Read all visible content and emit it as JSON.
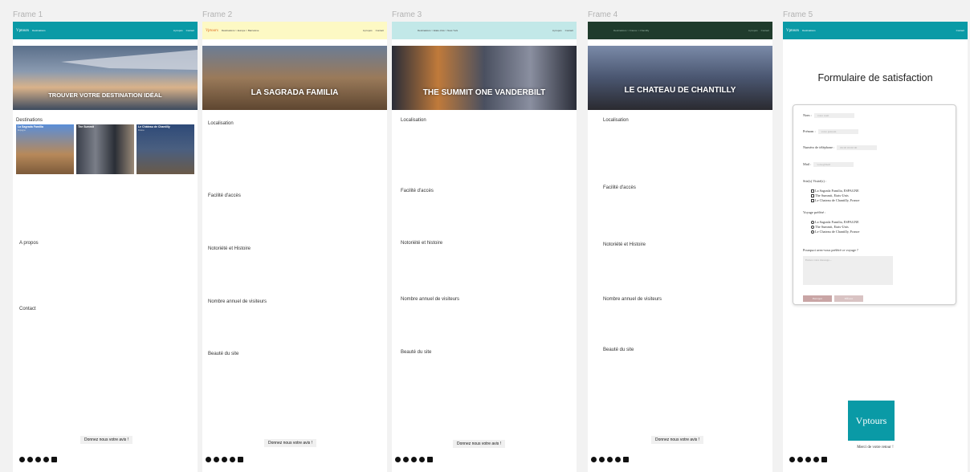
{
  "frames": [
    {
      "label": "Frame 1"
    },
    {
      "label": "Frame 2"
    },
    {
      "label": "Frame 3"
    },
    {
      "label": "Frame 4"
    },
    {
      "label": "Frame 5"
    }
  ],
  "colors": {
    "teal": "#0a9aa6",
    "yellow": "#fdf9c4",
    "light_teal": "#c2e8e8",
    "dark_green": "#1f3b2c"
  },
  "frame1": {
    "logo": "Vptours",
    "nav_dest": "Destinations",
    "nav_apropos": "A propos",
    "nav_contact": "Contact",
    "hero_title": "TROUVER VOTRE DESTINATION IDÉAL",
    "destinations_heading": "Destinations",
    "cards": [
      {
        "name": "La Sagrada Familia",
        "sub": "Espagne"
      },
      {
        "name": "The Summit",
        "sub": ""
      },
      {
        "name": "Le Château de Chantilly",
        "sub": "France"
      }
    ],
    "apropos": "A propos",
    "contact": "Contact",
    "cta": "Donnez nous votre avis !"
  },
  "frame2": {
    "logo": "Vptours",
    "breadcrumb": "Destinations > Europe > Barcelone",
    "nav_apropos": "A propos",
    "nav_contact": "Contact",
    "hero_title": "LA SAGRADA FAMILIA",
    "sections": [
      "Localisation",
      "Facilité d'accès",
      "Notoriété et Histoire",
      "Nombre annuel de visiteurs",
      "Beauté du site"
    ],
    "cta": "Donnez nous votre avis !"
  },
  "frame3": {
    "breadcrumb": "Destinations > Etats-Unis > New-York",
    "nav_apropos": "A propos",
    "nav_contact": "Contact",
    "hero_title": "THE SUMMIT ONE VANDERBILT",
    "sections": [
      "Localisation",
      "Facilité d'accès",
      "Notoriété et histoire",
      "Nombre annuel de visiteurs",
      "Beauté du site"
    ],
    "cta": "Donnez nous votre avis !"
  },
  "frame4": {
    "breadcrumb": "Destinations > France > Chantilly",
    "nav_apropos": "A propos",
    "nav_contact": "Contact",
    "hero_title": "LE CHATEAU DE CHANTILLY",
    "sections": [
      "Localisation",
      "Facilité d'accès",
      "Notoriété et Histoire",
      "Nombre annuel de visiteurs",
      "Beauté du site"
    ],
    "cta": "Donnez nous votre avis !"
  },
  "frame5": {
    "logo": "Vptours",
    "nav_dest": "Destinations",
    "nav_contact": "Contact",
    "title": "Formulaire de satisfaction",
    "form": {
      "nom_label": "Nom :",
      "nom_ph": "votre nom",
      "prenom_label": "Prénom :",
      "prenom_ph": "votre prénom",
      "tel_label": "Numéro de téléphone :",
      "tel_ph": "06 00 00 00 00",
      "mail_label": "Mail :",
      "mail_ph": "votre@mail",
      "sites_label": "Site(s) Visité(s) :",
      "sites": [
        "La Sagrada Familia, ESPAGNE",
        "The Summit, Etats-Unis",
        "Le Chateau de Chantilly, France"
      ],
      "pref_label": "Voyage préféré :",
      "prefs": [
        "La Sagrada Familia, ESPAGNE",
        "The Summit, Etats-Unis",
        "Le Chateau de Chantilly, France"
      ],
      "why_label": "Pourquoi avez-vous préféré ce voyage ?",
      "why_ph": "Entrez votre message...",
      "submit": "Envoyer",
      "clear": "Effacer"
    },
    "logo_card": "Vptours",
    "merci": "Merci de votre retour !"
  }
}
